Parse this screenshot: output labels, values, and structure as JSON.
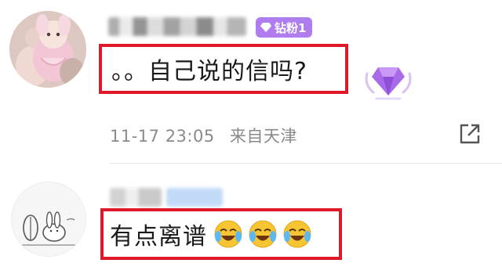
{
  "comment1": {
    "badge_label": "钻粉1",
    "text": "。。自己说的信吗?",
    "time": "11-17 23:05",
    "location": "来自天津"
  },
  "comment2": {
    "text": "有点离谱"
  },
  "icons": {
    "badge": "diamond-icon",
    "decor": "purple-diamond-icon",
    "share": "share-icon",
    "emoji": "laugh-cry-emoji"
  },
  "colors": {
    "highlight_border": "#e0182a",
    "badge_bg": "#b07df0",
    "meta_text": "#8a8a8a"
  }
}
